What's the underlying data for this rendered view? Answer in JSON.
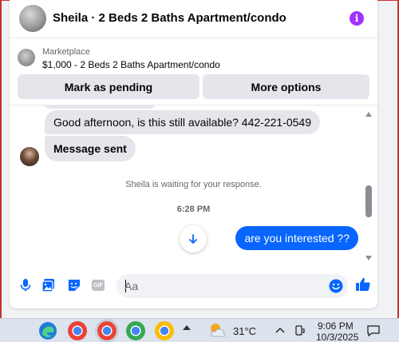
{
  "header": {
    "title": "Sheila · 2 Beds 2 Baths Apartment/condo",
    "info_icon": "info-icon"
  },
  "marketplace": {
    "label": "Marketplace",
    "listing": "$1,000 - 2 Beds 2 Baths Apartment/condo"
  },
  "actions": {
    "mark_pending": "Mark as pending",
    "more_options": "More options"
  },
  "messages": {
    "incoming": [
      {
        "text": "Good afternoon, is this still available? 442-221-0549"
      },
      {
        "text": "Message sent"
      }
    ],
    "waiting_notice": "Sheila is waiting for your response.",
    "timestamp": "6:28 PM",
    "outgoing": [
      {
        "text": "are you interested ??"
      }
    ]
  },
  "composer": {
    "placeholder": "Aa",
    "gif_label": "GIF",
    "icons": [
      "microphone-icon",
      "photo-icon",
      "sticker-icon",
      "gif-icon",
      "emoji-icon",
      "thumbs-up-icon"
    ]
  },
  "taskbar": {
    "weather_temp": "31°C",
    "time": "9:06 PM",
    "date": "10/3/2025"
  },
  "colors": {
    "accent": "#0866ff",
    "info": "#a033ff",
    "bubble_in": "#e4e6eb",
    "frame": "#c9302c"
  }
}
